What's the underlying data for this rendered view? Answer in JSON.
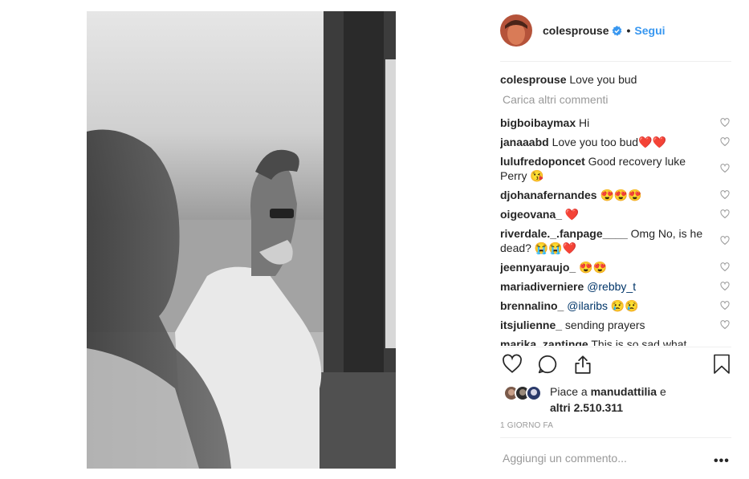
{
  "post": {
    "photo_alt": "",
    "author": "colesprouse",
    "follow_label": "Segui",
    "separator": "•",
    "caption_user": "colesprouse",
    "caption_text": "Love you bud",
    "load_more": "Carica altri commenti"
  },
  "comments": [
    {
      "user": "bigboibaymax",
      "text": "Hi",
      "mention": ""
    },
    {
      "user": "janaaabd",
      "text": "Love you too bud❤️❤️",
      "mention": ""
    },
    {
      "user": "lulufredoponcet",
      "text": "Good recovery luke Perry 😘",
      "mention": ""
    },
    {
      "user": "djohanafernandes",
      "text": "😍😍😍",
      "mention": ""
    },
    {
      "user": "oigeovana_",
      "text": "❤️",
      "mention": ""
    },
    {
      "user": "riverdale._.fanpage____",
      "text": "Omg No, is he dead? 😭😭❤️",
      "mention": ""
    },
    {
      "user": "jeennyaraujo_",
      "text": "😍😍",
      "mention": ""
    },
    {
      "user": "mariadiverniere",
      "text": "",
      "mention": "@rebby_t"
    },
    {
      "user": "brennalino_",
      "text": "😢😢",
      "mention": "@ilaribs"
    },
    {
      "user": "itsjulienne_",
      "text": "sending prayers",
      "mention": ""
    },
    {
      "user": "marika_zantinge",
      "text": "This is so sad what",
      "mention": ""
    }
  ],
  "likes": {
    "prefix": "Piace a",
    "user": "manudattilia",
    "joiner": "e",
    "others": "altri 2.510.311"
  },
  "timestamp": "1 giorno fa",
  "add_comment_placeholder": "Aggiungi un commento...",
  "more_options": "•••",
  "colors": {
    "link_blue": "#3897f0",
    "mention_blue": "#003569",
    "text": "#262626",
    "muted": "#999999",
    "heart_red": "#ed4956"
  },
  "icons": [
    "verified-badge-icon",
    "like-icon",
    "comment-icon",
    "share-icon",
    "bookmark-icon",
    "comment-like-icon",
    "more-options-icon"
  ]
}
